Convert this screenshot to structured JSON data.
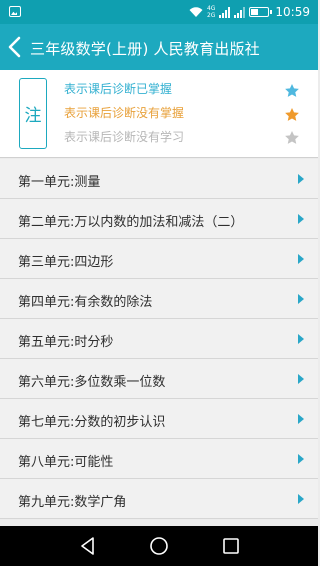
{
  "status_bar": {
    "network_top": "4G",
    "network_bottom": "2G",
    "time": "10:59",
    "battery_level": 0.45
  },
  "header": {
    "title": "三年级数学(上册) 人民教育出版社",
    "background": "#1da9bf"
  },
  "legend": {
    "note_label": "注",
    "rows": [
      {
        "text": "表示课后诊断已掌握",
        "color": "#35b1d1",
        "icon": "star-icon"
      },
      {
        "text": "表示课后诊断没有掌握",
        "color": "#e8a13b",
        "icon": "star-icon"
      },
      {
        "text": "表示课后诊断没有学习",
        "color": "#b7b7b7",
        "icon": "star-icon"
      }
    ]
  },
  "units": [
    {
      "label": "第一单元:测量"
    },
    {
      "label": "第二单元:万以内数的加法和减法（二）"
    },
    {
      "label": "第三单元:四边形"
    },
    {
      "label": "第四单元:有余数的除法"
    },
    {
      "label": "第五单元:时分秒"
    },
    {
      "label": "第六单元:多位数乘一位数"
    },
    {
      "label": "第七单元:分数的初步认识"
    },
    {
      "label": "第八单元:可能性"
    },
    {
      "label": "第九单元:数学广角"
    }
  ],
  "nav_bar": {
    "icons": [
      "back-triangle-icon",
      "home-circle-icon",
      "recent-square-icon"
    ]
  }
}
